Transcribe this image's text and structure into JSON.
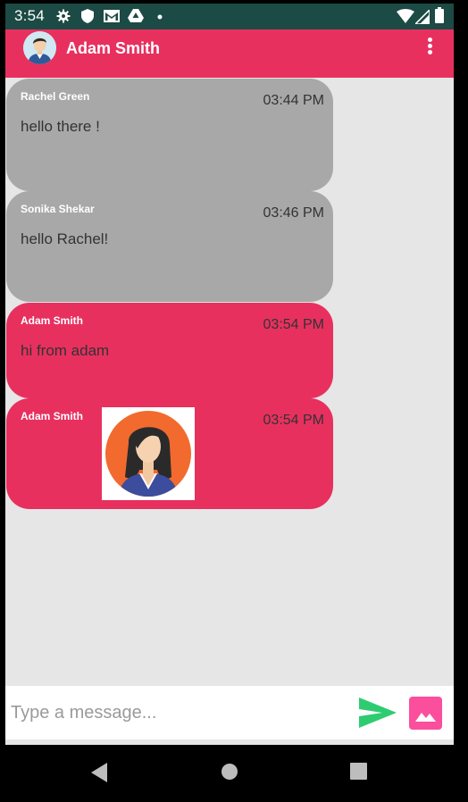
{
  "status_bar": {
    "time": "3:54",
    "icons_left": [
      "settings-icon",
      "shield-icon",
      "gmail-icon",
      "drive-icon",
      "dot-icon"
    ],
    "icons_right": [
      "wifi-icon",
      "signal-icon",
      "battery-icon"
    ]
  },
  "app_bar": {
    "title": "Adam Smith",
    "color": "#e8305f"
  },
  "messages": [
    {
      "sender": "Rachel  Green",
      "time": "03:44 PM",
      "text": "hello there !",
      "color": "#a8a8a8"
    },
    {
      "sender": "Sonika Shekar",
      "time": "03:46 PM",
      "text": "hello Rachel!",
      "color": "#a8a8a8"
    },
    {
      "sender": "Adam Smith",
      "time": "03:54 PM",
      "text": "hi from adam",
      "color": "#e8305f"
    },
    {
      "sender": "Adam Smith",
      "time": "03:54 PM",
      "attachment": "woman-avatar-image",
      "color": "#e8305f"
    }
  ],
  "composer": {
    "placeholder": "Type a message...",
    "send_icon": "send-icon",
    "send_color": "#2ecc71",
    "image_icon": "image-icon",
    "image_color": "#fb4e9c"
  },
  "nav_bar": {
    "icons": [
      "back-icon",
      "home-icon",
      "recents-icon"
    ]
  }
}
